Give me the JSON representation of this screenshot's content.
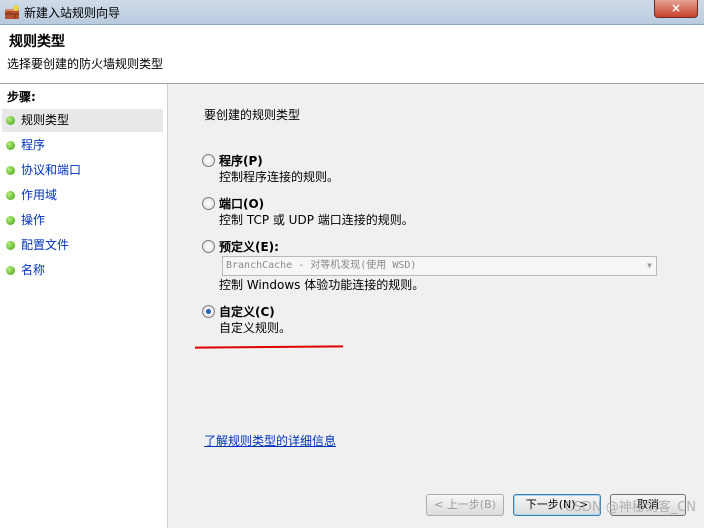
{
  "window": {
    "title": "新建入站规则向导",
    "close_label": "×"
  },
  "header": {
    "title": "规则类型",
    "subtitle": "选择要创建的防火墙规则类型"
  },
  "sidebar": {
    "steps_label": "步骤:",
    "items": [
      {
        "label": "规则类型"
      },
      {
        "label": "程序"
      },
      {
        "label": "协议和端口"
      },
      {
        "label": "作用域"
      },
      {
        "label": "操作"
      },
      {
        "label": "配置文件"
      },
      {
        "label": "名称"
      }
    ],
    "active_index": 0
  },
  "main": {
    "question": "要创建的规则类型",
    "options": [
      {
        "title": "程序(P)",
        "description": "控制程序连接的规则。",
        "selected": false
      },
      {
        "title": "端口(O)",
        "description": "控制 TCP 或 UDP 端口连接的规则。",
        "selected": false
      },
      {
        "title": "预定义(E):",
        "description": "控制 Windows 体验功能连接的规则。",
        "selected": false
      },
      {
        "title": "自定义(C)",
        "description": "自定义规则。",
        "selected": true
      }
    ],
    "predefined_dropdown": {
      "value": "BranchCache - 对等机发现(使用 WSD)",
      "disabled": true
    },
    "learn_more_link": "了解规则类型的详细信息"
  },
  "footer": {
    "back_label": "< 上一步(B)",
    "next_label": "下一步(N) >",
    "cancel_label": "取消"
  },
  "watermark": "CSDN @神秘剑客_CN",
  "colors": {
    "link": "#0033bb",
    "annotation_line": "#e00000",
    "step_dot": "#3c9a14"
  }
}
